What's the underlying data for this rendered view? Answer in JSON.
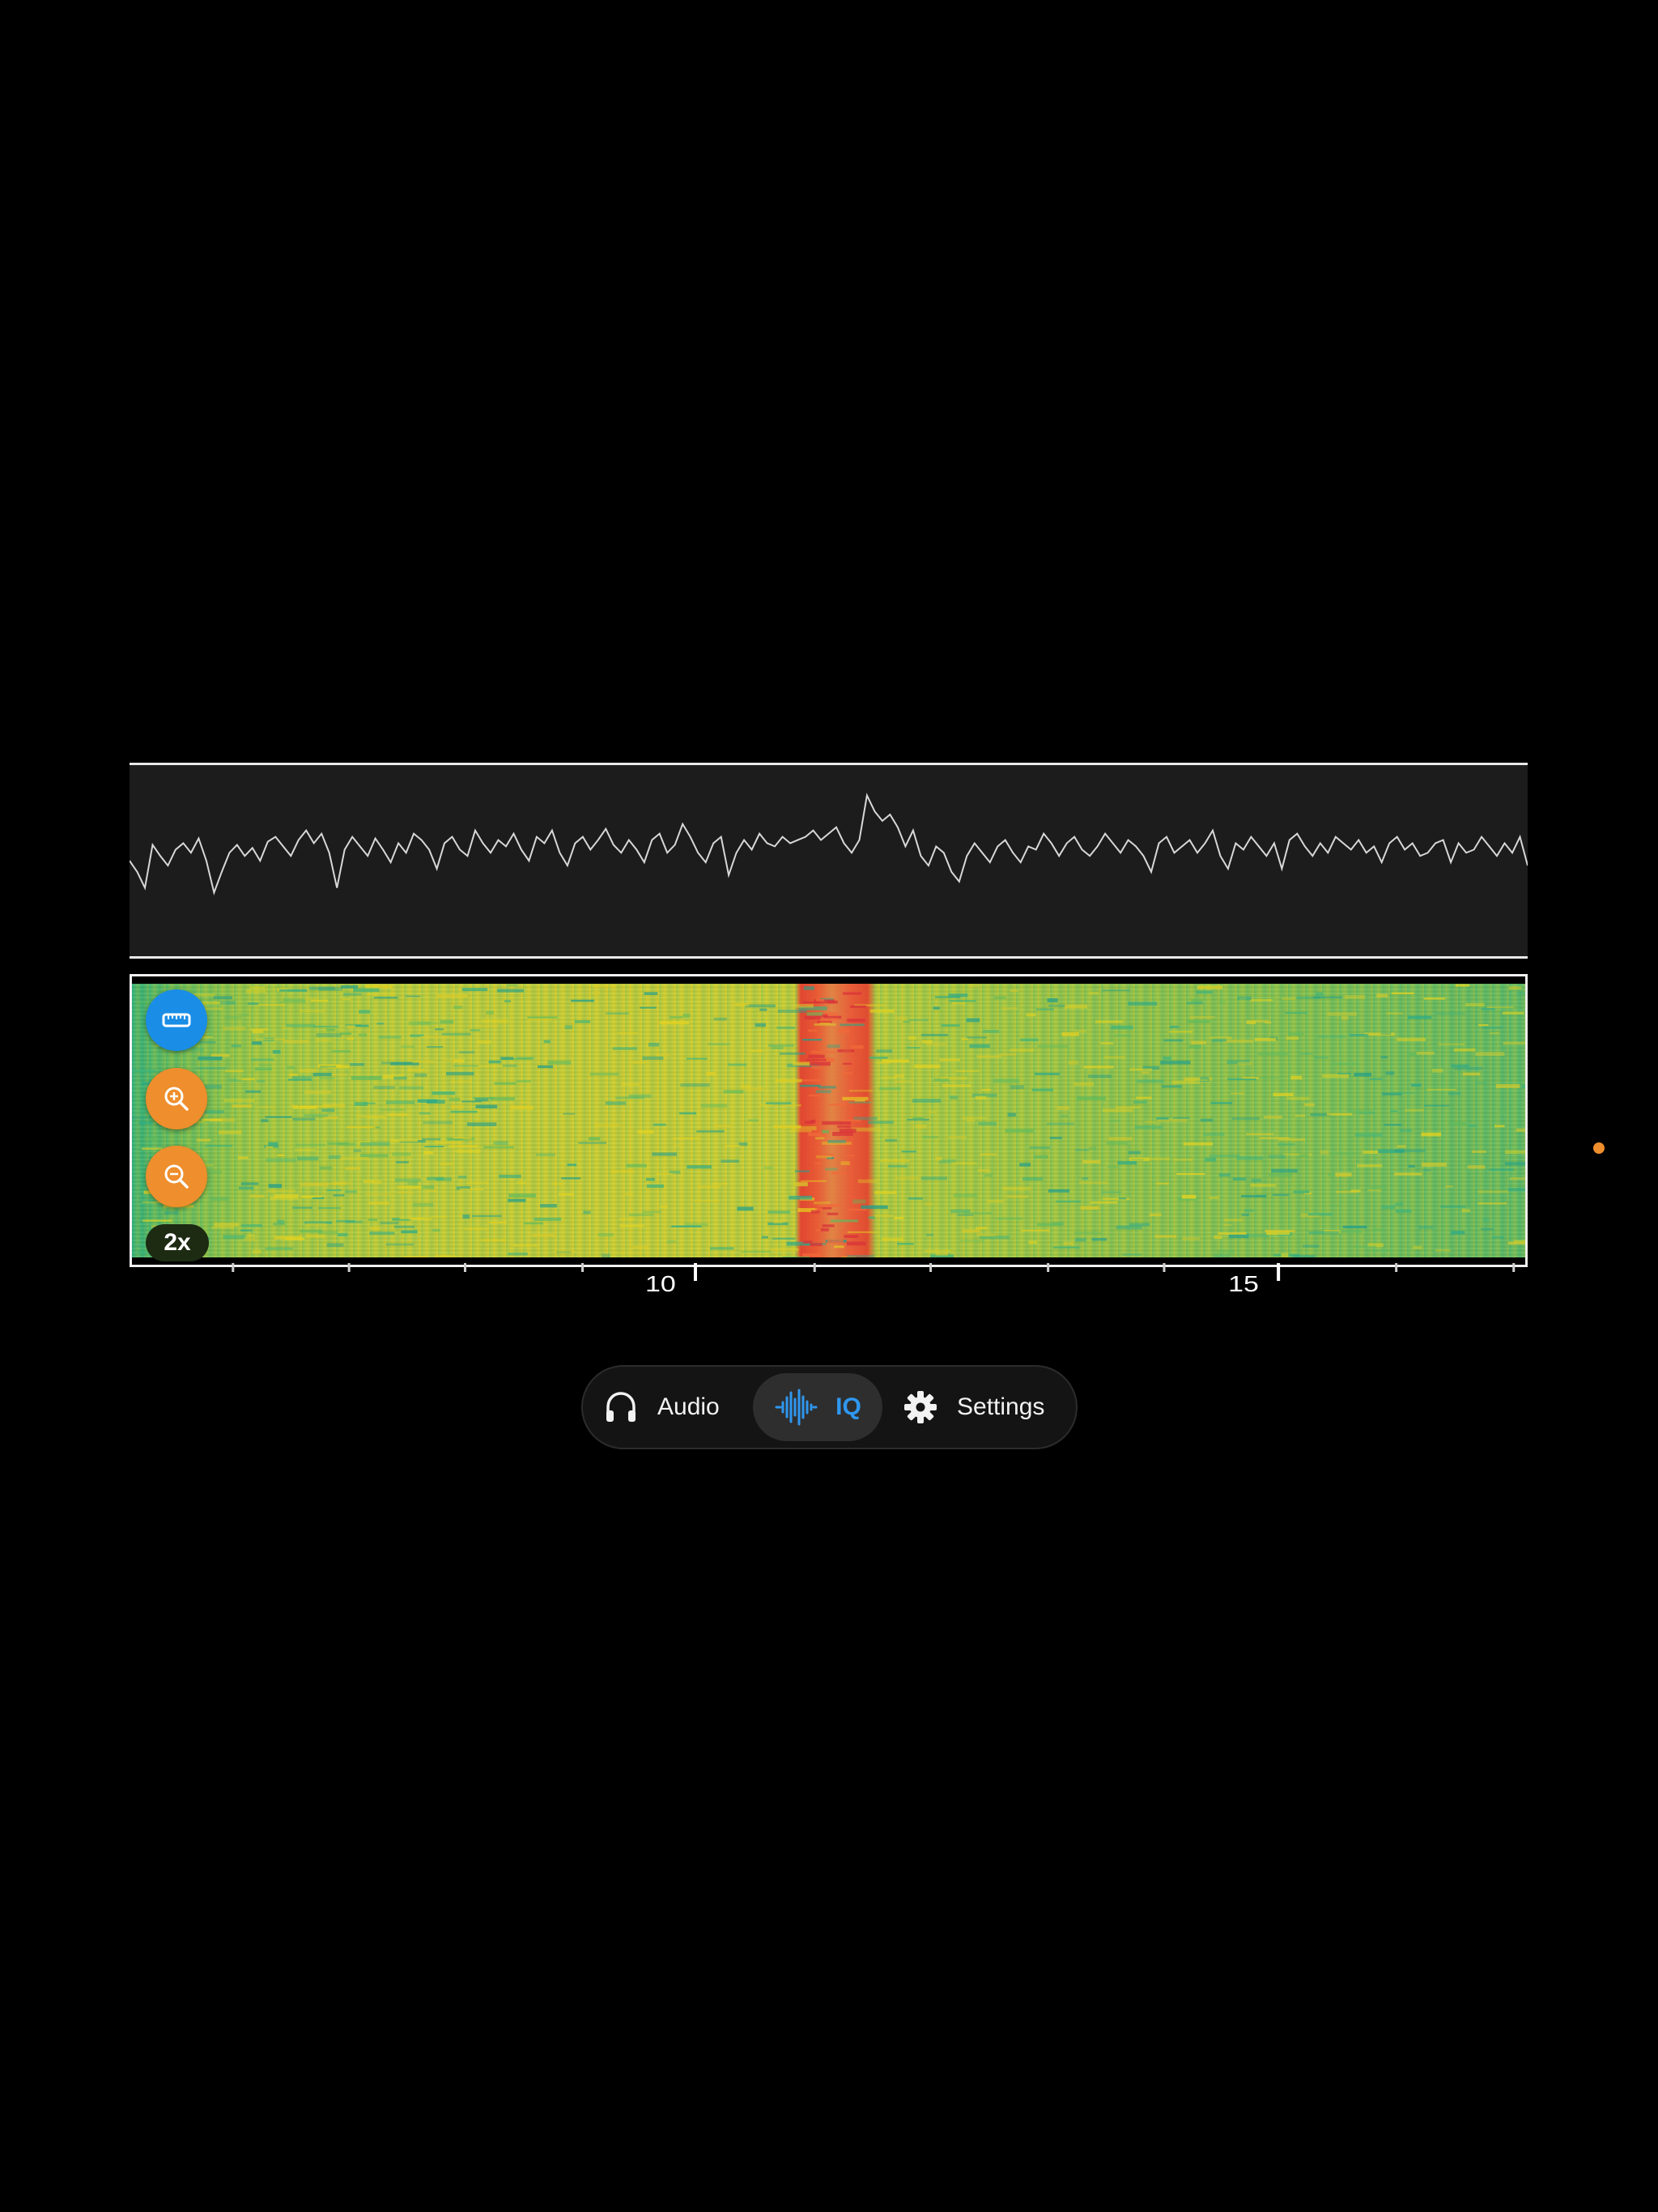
{
  "spectrum": {
    "line_color": "#d8d8d8",
    "background": "#1c1c1c",
    "samples": [
      0.55,
      0.62,
      0.72,
      0.45,
      0.52,
      0.58,
      0.48,
      0.44,
      0.5,
      0.41,
      0.55,
      0.75,
      0.62,
      0.5,
      0.45,
      0.52,
      0.47,
      0.55,
      0.43,
      0.4,
      0.46,
      0.52,
      0.42,
      0.36,
      0.44,
      0.38,
      0.5,
      0.72,
      0.48,
      0.4,
      0.46,
      0.52,
      0.41,
      0.48,
      0.56,
      0.44,
      0.5,
      0.38,
      0.42,
      0.48,
      0.6,
      0.44,
      0.4,
      0.48,
      0.52,
      0.36,
      0.44,
      0.5,
      0.42,
      0.46,
      0.38,
      0.48,
      0.55,
      0.4,
      0.44,
      0.36,
      0.5,
      0.58,
      0.44,
      0.4,
      0.48,
      0.42,
      0.35,
      0.45,
      0.5,
      0.42,
      0.48,
      0.56,
      0.42,
      0.38,
      0.5,
      0.45,
      0.32,
      0.4,
      0.5,
      0.56,
      0.44,
      0.4,
      0.64,
      0.5,
      0.42,
      0.48,
      0.38,
      0.44,
      0.46,
      0.4,
      0.44,
      0.42,
      0.4,
      0.36,
      0.42,
      0.38,
      0.34,
      0.44,
      0.5,
      0.42,
      0.14,
      0.24,
      0.3,
      0.26,
      0.34,
      0.46,
      0.36,
      0.52,
      0.58,
      0.46,
      0.5,
      0.62,
      0.68,
      0.52,
      0.44,
      0.5,
      0.56,
      0.46,
      0.42,
      0.5,
      0.56,
      0.46,
      0.48,
      0.38,
      0.44,
      0.52,
      0.44,
      0.4,
      0.48,
      0.52,
      0.46,
      0.38,
      0.44,
      0.5,
      0.42,
      0.46,
      0.52,
      0.62,
      0.44,
      0.4,
      0.5,
      0.46,
      0.42,
      0.5,
      0.44,
      0.36,
      0.52,
      0.6,
      0.44,
      0.48,
      0.4,
      0.46,
      0.52,
      0.44,
      0.6,
      0.42,
      0.38,
      0.46,
      0.52,
      0.44,
      0.5,
      0.4,
      0.44,
      0.48,
      0.42,
      0.5,
      0.46,
      0.56,
      0.44,
      0.4,
      0.48,
      0.44,
      0.52,
      0.5,
      0.44,
      0.42,
      0.56,
      0.44,
      0.5,
      0.48,
      0.4,
      0.46,
      0.52,
      0.44,
      0.5,
      0.4,
      0.58
    ]
  },
  "waterfall": {
    "palette_low": "#2fb07a",
    "palette_mid": "#d4cf30",
    "palette_high": "#e24030",
    "controls": {
      "ruler_icon": "ruler-icon",
      "zoom_in_icon": "zoom-in-icon",
      "zoom_out_icon": "zoom-out-icon",
      "zoom_level": "2x"
    }
  },
  "axis": {
    "labels": [
      {
        "text": "10",
        "position": 0.403
      },
      {
        "text": "15",
        "position": 0.82
      }
    ],
    "minor_tick_positions": [
      0.074,
      0.157,
      0.24,
      0.324,
      0.49,
      0.573,
      0.657,
      0.74,
      0.906,
      0.99
    ]
  },
  "mode_bar": {
    "tabs": [
      {
        "id": "audio",
        "label": "Audio",
        "icon": "headphones-icon",
        "selected": false
      },
      {
        "id": "iq",
        "label": "IQ",
        "icon": "waveform-icon",
        "selected": true
      },
      {
        "id": "settings",
        "label": "Settings",
        "icon": "gear-icon",
        "selected": false
      }
    ]
  },
  "colors": {
    "accent_blue": "#2f97ef",
    "accent_orange": "#ee8e2c",
    "background": "#000000"
  }
}
